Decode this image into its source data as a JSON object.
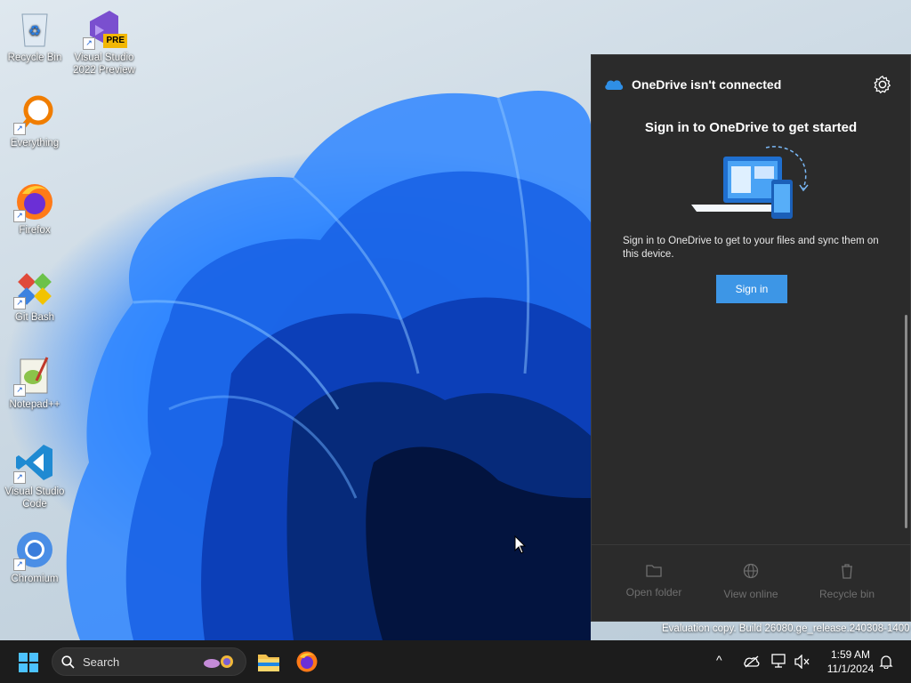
{
  "desktop": {
    "icons": [
      {
        "label": "Recycle Bin"
      },
      {
        "label": "Visual Studio 2022 Preview",
        "badge": "PRE"
      },
      {
        "label": "Everything"
      },
      {
        "label": "Firefox"
      },
      {
        "label": "Git Bash"
      },
      {
        "label": "Notepad++"
      },
      {
        "label": "Visual Studio Code"
      },
      {
        "label": "Chromium"
      }
    ],
    "watermark": "Evaluation copy. Build 26080.ge_release.240308-1400"
  },
  "onedrive": {
    "title": "OneDrive isn't connected",
    "heading": "Sign in to OneDrive to get started",
    "description": "Sign in to OneDrive to get to your files and sync them on this device.",
    "signin_label": "Sign in",
    "footer": {
      "open_folder": "Open folder",
      "view_online": "View online",
      "recycle_bin": "Recycle bin"
    },
    "colors": {
      "panel": "#2b2b2b",
      "accent": "#3d96e6"
    }
  },
  "taskbar": {
    "search_placeholder": "Search",
    "time": "1:59 AM",
    "date": "11/1/2024"
  }
}
